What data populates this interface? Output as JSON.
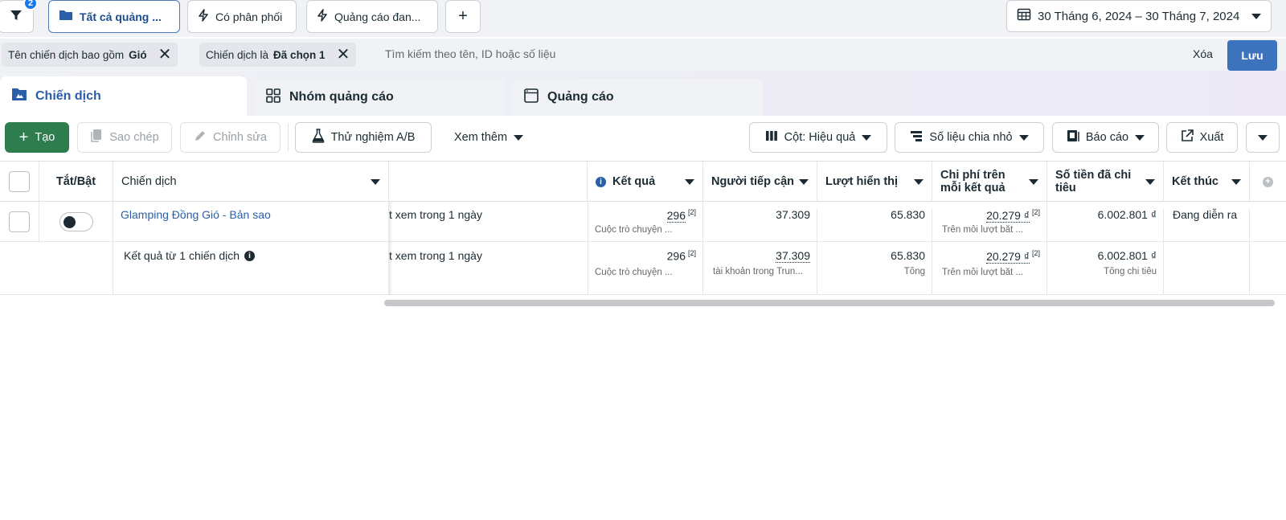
{
  "topbar": {
    "filter_count": "2",
    "chips": [
      {
        "label": "Tất cả quảng ..."
      },
      {
        "label": "Có phân phối"
      },
      {
        "label": "Quảng cáo đan..."
      }
    ],
    "add_label": "+",
    "date_range": "30 Tháng 6, 2024 – 30 Tháng 7, 2024"
  },
  "filters": {
    "chips": [
      {
        "prefix": "Tên chiến dịch bao gồm",
        "value": "Gió"
      },
      {
        "prefix": "Chiến dịch là",
        "value": "Đã chọn 1"
      }
    ],
    "search_placeholder": "Tìm kiếm theo tên, ID hoặc số liệu",
    "clear_label": "Xóa",
    "save_label": "Lưu"
  },
  "tabs": [
    {
      "label": "Chiến dịch"
    },
    {
      "label": "Nhóm quảng cáo"
    },
    {
      "label": "Quảng cáo"
    }
  ],
  "toolbar": {
    "create": "Tạo",
    "copy": "Sao chép",
    "edit": "Chỉnh sửa",
    "ab_test": "Thử nghiệm A/B",
    "more": "Xem thêm",
    "columns": "Cột: Hiệu quả",
    "breakdown": "Số liệu chia nhỏ",
    "reports": "Báo cáo",
    "export": "Xuất"
  },
  "table": {
    "headers": {
      "toggle": "Tắt/Bật",
      "campaign": "Chiến dịch",
      "results": "Kết quả",
      "reach": "Người tiếp cận",
      "impressions": "Lượt hiển thị",
      "cost_per_result_1": "Chi phí trên",
      "cost_per_result_2": "mỗi kết quả",
      "spent_1": "Số tiền đã chi",
      "spent_2": "tiêu",
      "ends": "Kết thúc"
    },
    "rows": [
      {
        "campaign": "Glamping Đồng Gió - Bản sao",
        "attribution": "t xem trong 1 ngày",
        "results": "296",
        "results_note": "[2]",
        "results_sub": "Cuộc trò chuyện ...",
        "reach": "37.309",
        "impressions": "65.830",
        "cost": "20.279 ₫",
        "cost_note": "[2]",
        "cost_sub": "Trên mỗi lượt bắt ...",
        "spent": "6.002.801 ₫",
        "ends": "Đang diễn ra",
        "enabled": false
      }
    ],
    "summary": {
      "label": "Kết quả từ 1 chiến dịch",
      "attribution": "t xem trong 1 ngày",
      "results": "296",
      "results_note": "[2]",
      "results_sub": "Cuộc trò chuyện ...",
      "reach": "37.309",
      "reach_sub": "tài khoản trong Trun...",
      "impressions": "65.830",
      "impressions_sub": "Tổng",
      "cost": "20.279 ₫",
      "cost_note": "[2]",
      "cost_sub": "Trên mỗi lượt bắt ...",
      "spent": "6.002.801 ₫",
      "spent_sub": "Tổng chi tiêu"
    }
  },
  "colors": {
    "accent": "#1877f2",
    "create_button": "#2e7d4f",
    "save_button": "#3d73bd",
    "link": "#2a5ea8"
  }
}
